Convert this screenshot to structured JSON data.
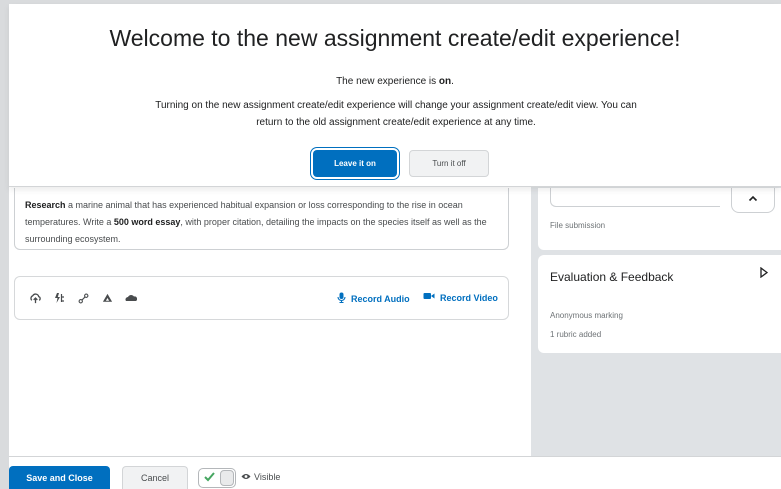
{
  "dialog": {
    "title": "Welcome to the new assignment create/edit experience!",
    "status_prefix": "The new experience is ",
    "status_value": "on",
    "status_suffix": ".",
    "body": "Turning on the new assignment create/edit experience will change your assignment create/edit view. You can return to the old assignment create/edit experience at any time.",
    "leave_on_label": "Leave it on",
    "turn_off_label": "Turn it off"
  },
  "description": {
    "part1_bold": "Research",
    "part2": " a marine animal that has experienced habitual expansion or loss corresponding to the rise in ocean temperatures. Write a ",
    "part3_bold": "500 word essay",
    "part4": ", with proper citation, detailing the impacts on the species itself as well as the surrounding ecosystem."
  },
  "attachments": {
    "icons": [
      "upload-icon",
      "link-icon",
      "quicklink-icon",
      "google-drive-icon",
      "onedrive-icon"
    ],
    "record_audio_label": "Record Audio",
    "record_video_label": "Record Video"
  },
  "sidebar": {
    "submission_type": "File submission",
    "evaluation": {
      "title": "Evaluation & Feedback",
      "line1": "Anonymous marking",
      "line2": "1 rubric added"
    }
  },
  "footer": {
    "save_label": "Save and Close",
    "cancel_label": "Cancel",
    "visible_label": "Visible",
    "visible_on": true
  },
  "colors": {
    "primary": "#006fbf",
    "sidebar_bg": "#dfe2e5",
    "toggle_check": "#46a661"
  }
}
